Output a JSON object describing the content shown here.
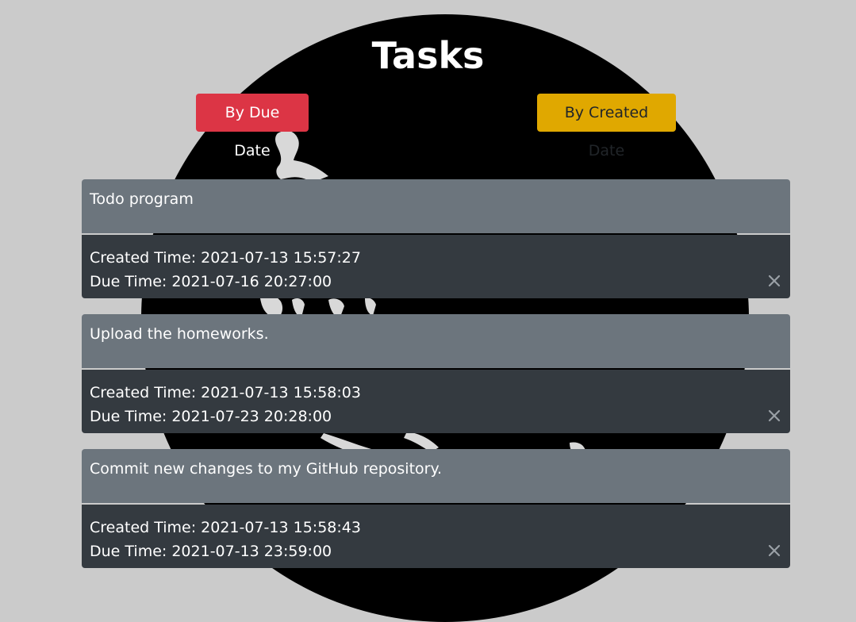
{
  "page": {
    "title": "Tasks"
  },
  "sort": {
    "by_due_label": "By Due Date",
    "by_created_label": "By Created Date"
  },
  "colors": {
    "background": "#cbcbcb",
    "circle": "#000000",
    "task_head": "#6c757d",
    "task_body": "#343a40",
    "due_button": "#dc3545",
    "created_button": "#e0a800"
  },
  "tasks": [
    {
      "title": "Todo program",
      "created": "Created Time: 2021-07-13 15:57:27",
      "due": "Due Time: 2021-07-16 20:27:00",
      "delete_icon": "close-icon"
    },
    {
      "title": "Upload the homeworks.",
      "created": "Created Time: 2021-07-13 15:58:03",
      "due": "Due Time: 2021-07-23 20:28:00",
      "delete_icon": "close-icon"
    },
    {
      "title": "Commit new changes to my GitHub repository.",
      "created": "Created Time: 2021-07-13 15:58:43",
      "due": "Due Time: 2021-07-13 23:59:00",
      "delete_icon": "close-icon"
    }
  ]
}
